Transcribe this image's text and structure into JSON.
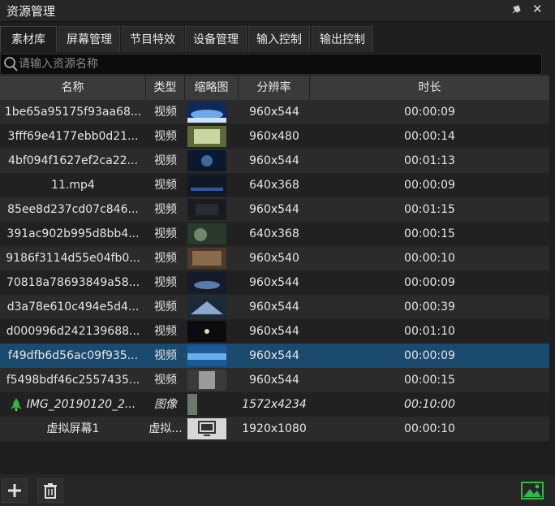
{
  "window": {
    "title": "资源管理"
  },
  "tabs": [
    {
      "label": "素材库",
      "active": true
    },
    {
      "label": "屏幕管理",
      "active": false
    },
    {
      "label": "节目特效",
      "active": false
    },
    {
      "label": "设备管理",
      "active": false
    },
    {
      "label": "输入控制",
      "active": false
    },
    {
      "label": "输出控制",
      "active": false
    }
  ],
  "search": {
    "placeholder": "请输入资源名称",
    "value": ""
  },
  "table": {
    "headers": {
      "name": "名称",
      "type": "类型",
      "thumb": "缩略图",
      "resolution": "分辨率",
      "duration": "时长"
    },
    "rows": [
      {
        "name": "1be65a95175f93aa68...",
        "type": "视频",
        "resolution": "960x544",
        "duration": "00:00:09"
      },
      {
        "name": "3fff69e4177ebb0d21...",
        "type": "视频",
        "resolution": "960x480",
        "duration": "00:00:14"
      },
      {
        "name": "4bf094f1627ef2ca22...",
        "type": "视频",
        "resolution": "960x544",
        "duration": "00:01:13"
      },
      {
        "name": "11.mp4",
        "type": "视频",
        "resolution": "640x368",
        "duration": "00:00:09"
      },
      {
        "name": "85ee8d237cd07c846...",
        "type": "视频",
        "resolution": "960x544",
        "duration": "00:01:15"
      },
      {
        "name": "391ac902b995d8bb4...",
        "type": "视频",
        "resolution": "640x368",
        "duration": "00:00:15"
      },
      {
        "name": "9186f3114d55e04fb0...",
        "type": "视频",
        "resolution": "960x540",
        "duration": "00:00:10"
      },
      {
        "name": "70818a78693849a58...",
        "type": "视频",
        "resolution": "960x544",
        "duration": "00:00:09"
      },
      {
        "name": "d3a78e610c494e5d4...",
        "type": "视频",
        "resolution": "960x544",
        "duration": "00:00:39"
      },
      {
        "name": "d000996d242139688...",
        "type": "视频",
        "resolution": "960x544",
        "duration": "00:01:10"
      },
      {
        "name": "f49dfb6d56ac09f935...",
        "type": "视频",
        "resolution": "960x544",
        "duration": "00:00:09",
        "selected": true
      },
      {
        "name": "f5498bdf46c2557435...",
        "type": "视频",
        "resolution": "960x544",
        "duration": "00:00:15"
      },
      {
        "name": "IMG_20190120_2...",
        "type": "图像",
        "resolution": "1572x4234",
        "duration": "00:10:00",
        "italic": true
      },
      {
        "name": "虚拟屏幕1",
        "type": "虚拟...",
        "resolution": "1920x1080",
        "duration": "00:00:10"
      }
    ]
  },
  "colors": {
    "selected_row": "#1a4a6e",
    "accent_green": "#2fb84a"
  },
  "icons": {
    "pin": "pin-icon",
    "close": "close-icon",
    "search": "search-icon",
    "add": "plus-icon",
    "delete": "trash-icon",
    "image": "image-icon",
    "screen": "monitor-icon",
    "rocket": "rocket-icon"
  }
}
